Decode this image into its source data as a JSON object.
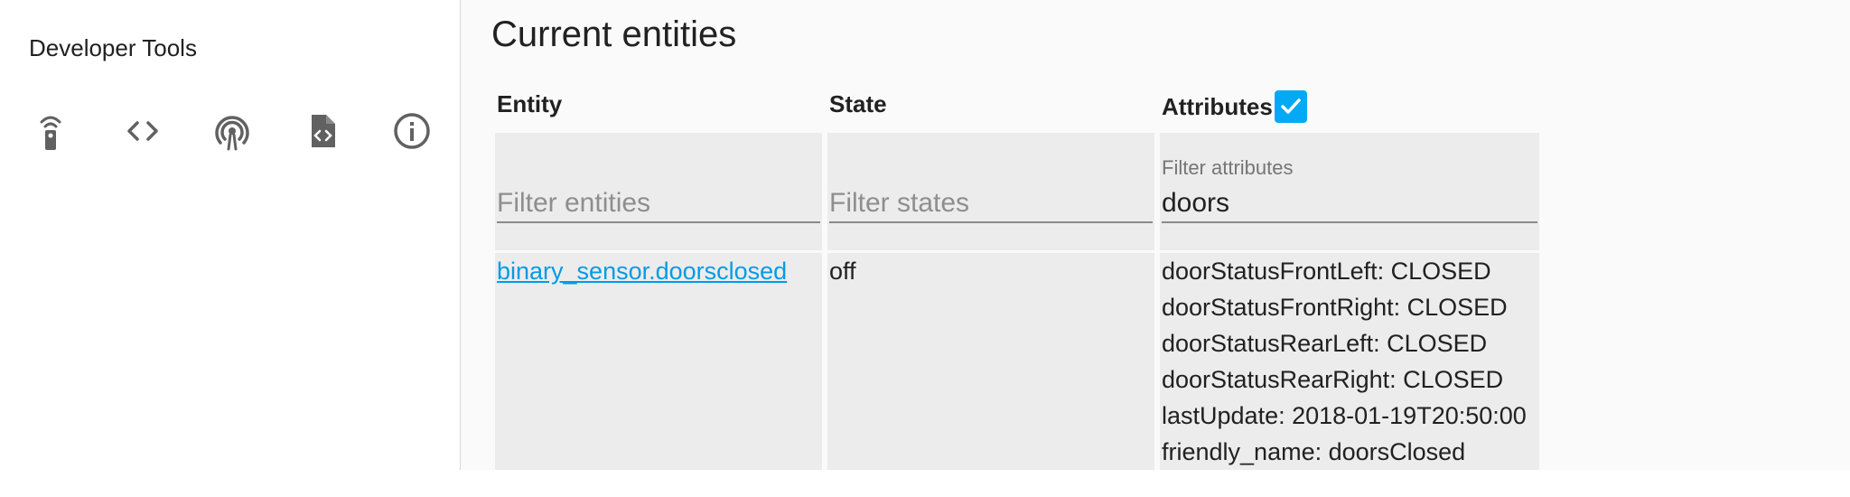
{
  "sidebar": {
    "title": "Developer Tools",
    "tools": [
      {
        "name": "services-tool",
        "icon": "remote-icon"
      },
      {
        "name": "templates-tool",
        "icon": "code-icon"
      },
      {
        "name": "events-tool",
        "icon": "broadcast-icon"
      },
      {
        "name": "template-file-tool",
        "icon": "file-code-icon"
      },
      {
        "name": "info-tool",
        "icon": "info-icon"
      }
    ]
  },
  "main": {
    "title": "Current entities",
    "columns": {
      "entity": "Entity",
      "state": "State",
      "attributes": "Attributes"
    },
    "attributes_checkbox_checked": true,
    "filters": {
      "entity_placeholder": "Filter entities",
      "state_placeholder": "Filter states",
      "attributes_label": "Filter attributes",
      "attributes_value": "doors"
    },
    "rows": [
      {
        "entity": "binary_sensor.doorsclosed",
        "state": "off",
        "attributes": [
          "doorStatusFrontLeft: CLOSED",
          "doorStatusFrontRight: CLOSED",
          "doorStatusRearLeft: CLOSED",
          "doorStatusRearRight: CLOSED",
          "lastUpdate: 2018-01-19T20:50:00",
          "friendly_name: doorsClosed"
        ]
      }
    ]
  },
  "colors": {
    "accent": "#03a9f4",
    "link": "#039be5",
    "icon": "#616161",
    "cell_bg": "#ececec"
  }
}
